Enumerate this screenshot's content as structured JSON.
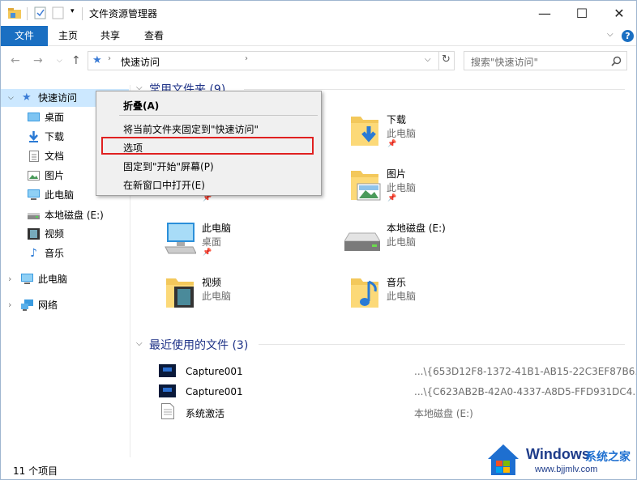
{
  "window": {
    "title": "文件资源管理器"
  },
  "ribbon": {
    "tabs": [
      "文件",
      "主页",
      "共享",
      "查看"
    ]
  },
  "address": {
    "location": "快速访问"
  },
  "search": {
    "placeholder": "搜索\"快速访问\""
  },
  "sidebar": {
    "items": [
      {
        "label": "快速访问"
      },
      {
        "label": "桌面"
      },
      {
        "label": "下载"
      },
      {
        "label": "文档"
      },
      {
        "label": "图片"
      },
      {
        "label": "此电脑"
      },
      {
        "label": "本地磁盘 (E:)"
      },
      {
        "label": "视频"
      },
      {
        "label": "音乐"
      },
      {
        "label": "此电脑"
      },
      {
        "label": "网络"
      }
    ]
  },
  "frequent": {
    "header": "常用文件夹 (9)",
    "tiles": [
      {
        "name": "下载",
        "sub": "此电脑"
      },
      {
        "name": "图片",
        "sub": "此电脑"
      },
      {
        "name": "此电脑",
        "sub": "桌面"
      },
      {
        "name": "本地磁盘 (E:)",
        "sub": "此电脑"
      },
      {
        "name": "视频",
        "sub": "此电脑"
      },
      {
        "name": "音乐",
        "sub": "此电脑"
      }
    ]
  },
  "recent": {
    "header": "最近使用的文件 (3)",
    "files": [
      {
        "name": "Capture001",
        "path": "...\\{653D12F8-1372-41B1-AB15-22C3EF87B6..."
      },
      {
        "name": "Capture001",
        "path": "...\\{C623AB2B-42A0-4337-A8D5-FFD931DC4..."
      },
      {
        "name": "系统激活",
        "path": "本地磁盘 (E:)"
      }
    ]
  },
  "context_menu": {
    "items": [
      {
        "label": "折叠(A)"
      },
      {
        "label": "将当前文件夹固定到\"快速访问\""
      },
      {
        "label": "选项"
      },
      {
        "label": "固定到\"开始\"屏幕(P)"
      },
      {
        "label": "在新窗口中打开(E)"
      }
    ]
  },
  "status": {
    "count": "11 个项目"
  },
  "watermark": {
    "brand": "Windows",
    "site_name": "系统之家",
    "url": "www.bjjmlv.com"
  },
  "colors": {
    "accent": "#1a6fc2",
    "folder": "#f3c85b",
    "selection": "#cce8ff",
    "highlight_box": "#e02020",
    "group_header": "#1e3287"
  }
}
